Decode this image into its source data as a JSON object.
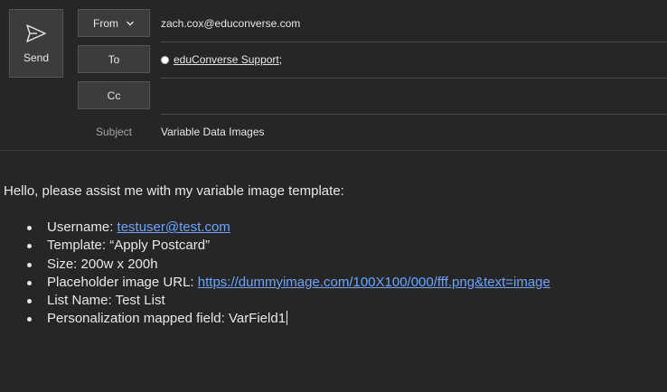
{
  "compose": {
    "send_label": "Send",
    "from_label": "From",
    "to_label": "To",
    "cc_label": "Cc",
    "subject_label": "Subject",
    "from_value": "zach.cox@educonverse.com",
    "to_recipient": "eduConverse Support",
    "to_separator": ";",
    "cc_value": "",
    "subject_value": "Variable Data Images"
  },
  "body": {
    "greeting": "Hello, please assist me with my variable image template:",
    "items": [
      {
        "label": "Username: ",
        "value": "testuser@test.com"
      },
      {
        "label": "Template: “Apply Postcard”",
        "value": ""
      },
      {
        "label": "Size: 200w x 200h",
        "value": ""
      },
      {
        "label": "Placeholder image URL: ",
        "value": "https://dummyimage.com/100X100/000/fff.png&text=image"
      },
      {
        "label": "List Name: Test List",
        "value": ""
      },
      {
        "label": "Personalization mapped field: VarField1",
        "value": ""
      }
    ]
  },
  "icons": {
    "send": "send-icon",
    "from_dropdown": "chevron-down-icon",
    "recipient": "recipient-status-icon"
  },
  "colors": {
    "background": "#262626",
    "button": "#3c3c3c",
    "link": "#6fa4ff",
    "text": "#e8e8e8"
  }
}
